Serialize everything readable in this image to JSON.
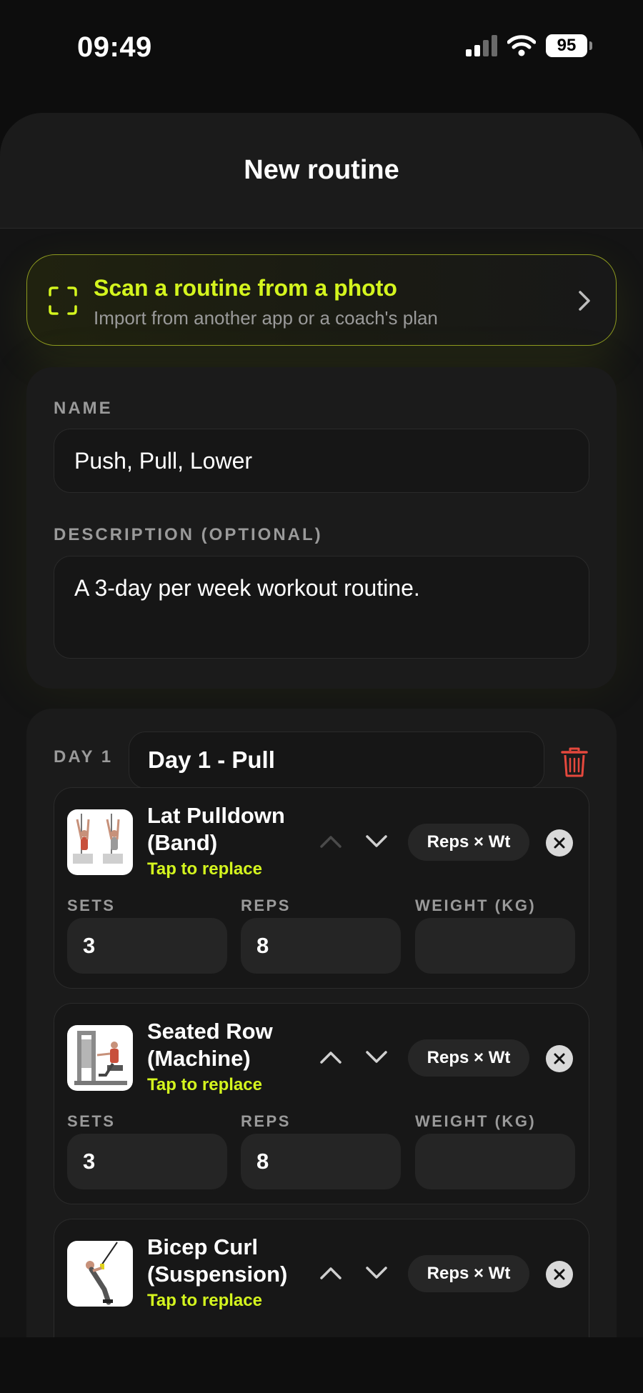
{
  "status": {
    "time": "09:49",
    "battery": "95"
  },
  "header": {
    "title": "New routine"
  },
  "scan": {
    "title": "Scan a routine from a photo",
    "subtitle": "Import from another app or a coach's plan"
  },
  "form": {
    "name_label": "NAME",
    "name_value": "Push, Pull, Lower",
    "description_label": "DESCRIPTION (OPTIONAL)",
    "description_value": "A 3-day per week workout routine."
  },
  "day": {
    "label": "DAY 1",
    "name": "Day 1 - Pull",
    "exercises": [
      {
        "name_line1": "Lat Pulldown",
        "name_line2": "(Band)",
        "replace": "Tap to replace",
        "mode": "Reps × Wt",
        "sets_label": "SETS",
        "sets": "3",
        "reps_label": "REPS",
        "reps": "8",
        "weight_label": "WEIGHT (KG)",
        "weight": ""
      },
      {
        "name_line1": "Seated Row",
        "name_line2": "(Machine)",
        "replace": "Tap to replace",
        "mode": "Reps × Wt",
        "sets_label": "SETS",
        "sets": "3",
        "reps_label": "REPS",
        "reps": "8",
        "weight_label": "WEIGHT (KG)",
        "weight": ""
      },
      {
        "name_line1": "Bicep Curl",
        "name_line2": "(Suspension)",
        "replace": "Tap to replace",
        "mode": "Reps × Wt"
      }
    ]
  },
  "colors": {
    "accent": "#d4f51e",
    "danger": "#e5483d",
    "background": "#0d0d0d",
    "card": "#1b1b1b"
  }
}
